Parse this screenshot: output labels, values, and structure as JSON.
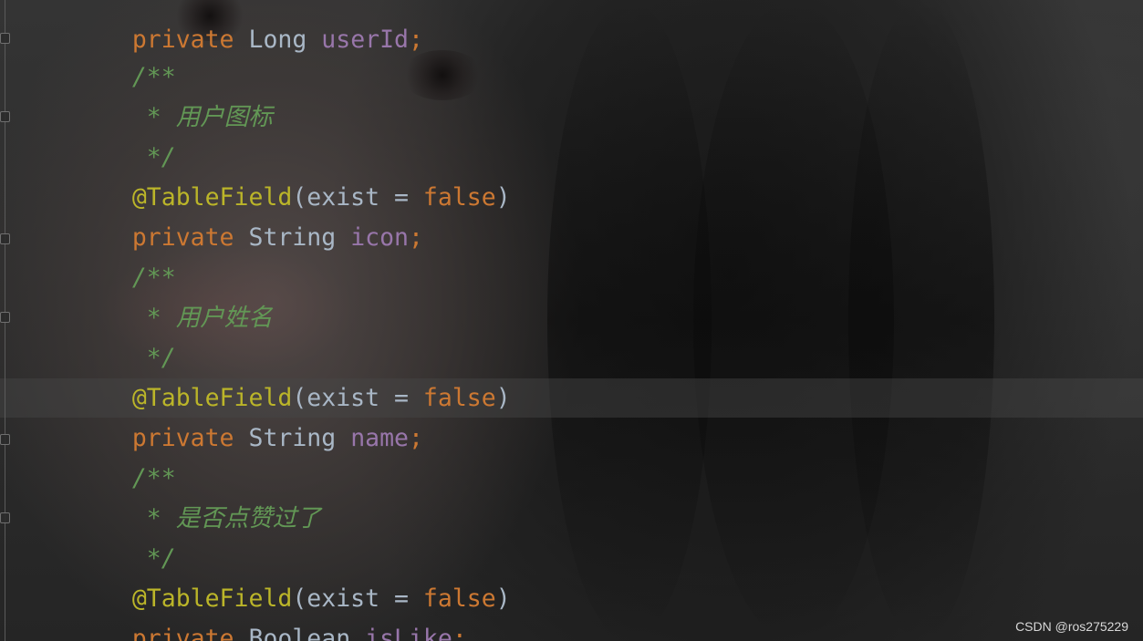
{
  "editor": {
    "theme": "dark",
    "colors": {
      "background": "#2b2b2b",
      "keyword": "#cc7832",
      "type": "#a9b7c6",
      "field": "#9876aa",
      "annotation": "#bbb529",
      "comment": "#629755"
    },
    "lines": {
      "l0": {
        "kw": "private",
        "type": "Long",
        "field": "userId",
        "semi": ";"
      },
      "l1": {
        "text": "/**"
      },
      "l2": {
        "star": " * ",
        "text": "用户图标"
      },
      "l3": {
        "text": " */"
      },
      "l4": {
        "ann": "@TableField",
        "open": "(exist = ",
        "val": "false",
        "close": ")"
      },
      "l5": {
        "kw": "private",
        "type": "String",
        "field": "icon",
        "semi": ";"
      },
      "l6": {
        "text": "/**"
      },
      "l7": {
        "star": " * ",
        "text": "用户姓名"
      },
      "l8": {
        "text": " */"
      },
      "l9": {
        "ann": "@TableField",
        "open": "(exist = ",
        "val": "false",
        "close": ")"
      },
      "l10": {
        "kw": "private",
        "type": "String",
        "field": "name",
        "semi": ";"
      },
      "l11": {
        "text": "/**"
      },
      "l12": {
        "star": " * ",
        "text": "是否点赞过了"
      },
      "l13": {
        "text": " */"
      },
      "l14": {
        "ann": "@TableField",
        "open": "(exist = ",
        "val": "false",
        "close": ")"
      },
      "l15": {
        "kw": "private",
        "type": "Boolean",
        "field": "isLike",
        "semi": ";"
      }
    }
  },
  "watermark": {
    "text": "CSDN @ros275229"
  }
}
